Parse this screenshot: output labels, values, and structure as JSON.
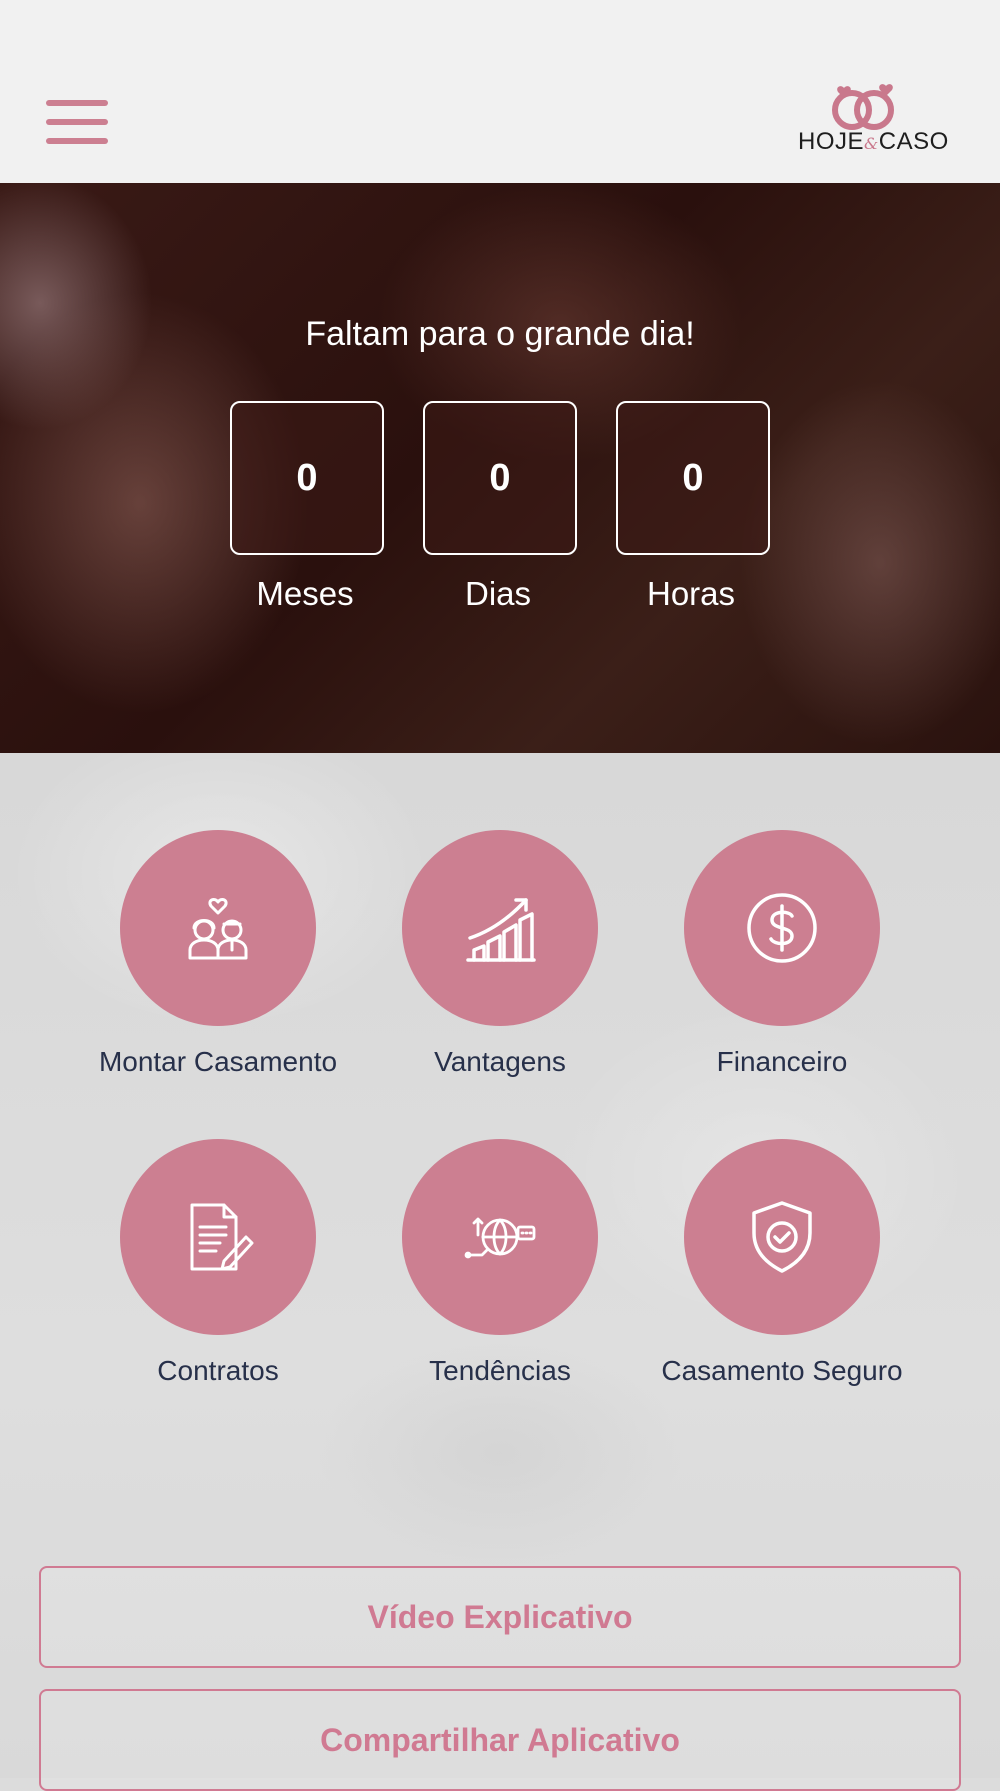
{
  "header": {
    "menu_icon": "hamburger-menu-icon",
    "logo": {
      "word1": "HOJE",
      "amp": "&",
      "word2": "CASO"
    }
  },
  "countdown": {
    "title": "Faltam para o grande dia!",
    "items": [
      {
        "value": "0",
        "label": "Meses"
      },
      {
        "value": "0",
        "label": "Dias"
      },
      {
        "value": "0",
        "label": "Horas"
      }
    ]
  },
  "menu": {
    "items": [
      {
        "label": "Montar Casamento",
        "icon": "couple-icon"
      },
      {
        "label": "Vantagens",
        "icon": "growth-chart-icon"
      },
      {
        "label": "Financeiro",
        "icon": "dollar-icon"
      },
      {
        "label": "Contratos",
        "icon": "contract-icon"
      },
      {
        "label": "Tendências",
        "icon": "globe-trends-icon"
      },
      {
        "label": "Casamento Seguro",
        "icon": "shield-check-icon"
      }
    ]
  },
  "buttons": {
    "video": "Vídeo Explicativo",
    "share": "Compartilhar Aplicativo"
  },
  "colors": {
    "accent": "#cc7f91",
    "label_text": "#27304a",
    "header_bg": "#f1f1f1"
  }
}
